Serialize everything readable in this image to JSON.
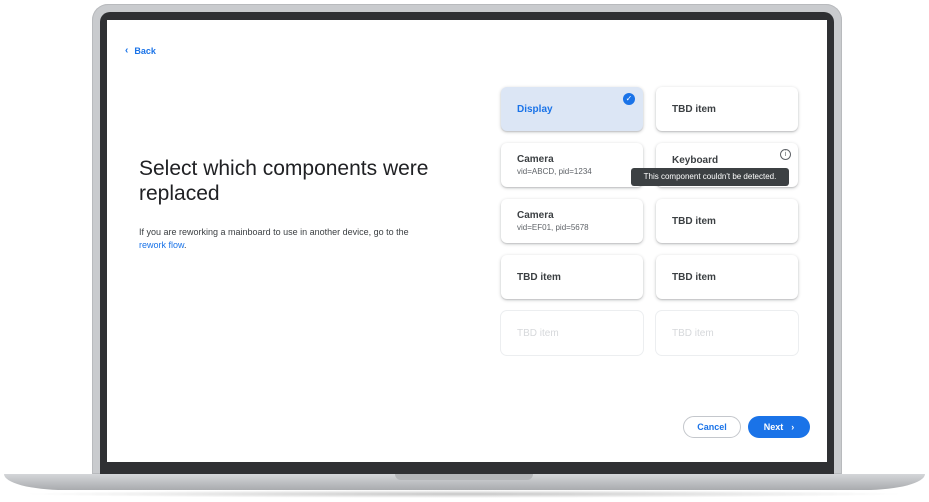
{
  "back": {
    "label": "Back"
  },
  "heading": "Select which components were replaced",
  "description": {
    "text": "If you are reworking a mainboard to use in another device, go to the ",
    "link": "rework flow",
    "suffix": "."
  },
  "components": [
    {
      "name": "Display",
      "state": "selected"
    },
    {
      "name": "TBD item",
      "state": "normal"
    },
    {
      "name": "Camera",
      "sub": "vid=ABCD, pid=1234",
      "state": "normal"
    },
    {
      "name": "Keyboard",
      "state": "not-detected"
    },
    {
      "name": "Camera",
      "sub": "vid=EF01, pid=5678",
      "state": "normal"
    },
    {
      "name": "TBD item",
      "state": "normal"
    },
    {
      "name": "TBD item",
      "state": "normal"
    },
    {
      "name": "TBD item",
      "state": "normal"
    },
    {
      "name": "TBD item",
      "state": "disabled"
    },
    {
      "name": "TBD item",
      "state": "disabled"
    }
  ],
  "tooltip": "This component couldn't be detected.",
  "buttons": {
    "cancel": "Cancel",
    "next": "Next"
  },
  "icons": {
    "back": "chevron-left-icon",
    "check": "check-circle-icon",
    "info": "info-icon",
    "next": "chevron-right-icon"
  },
  "colors": {
    "accent": "#1a73e8",
    "selected_bg": "#dce6f5",
    "tooltip_bg": "#3c4043"
  }
}
